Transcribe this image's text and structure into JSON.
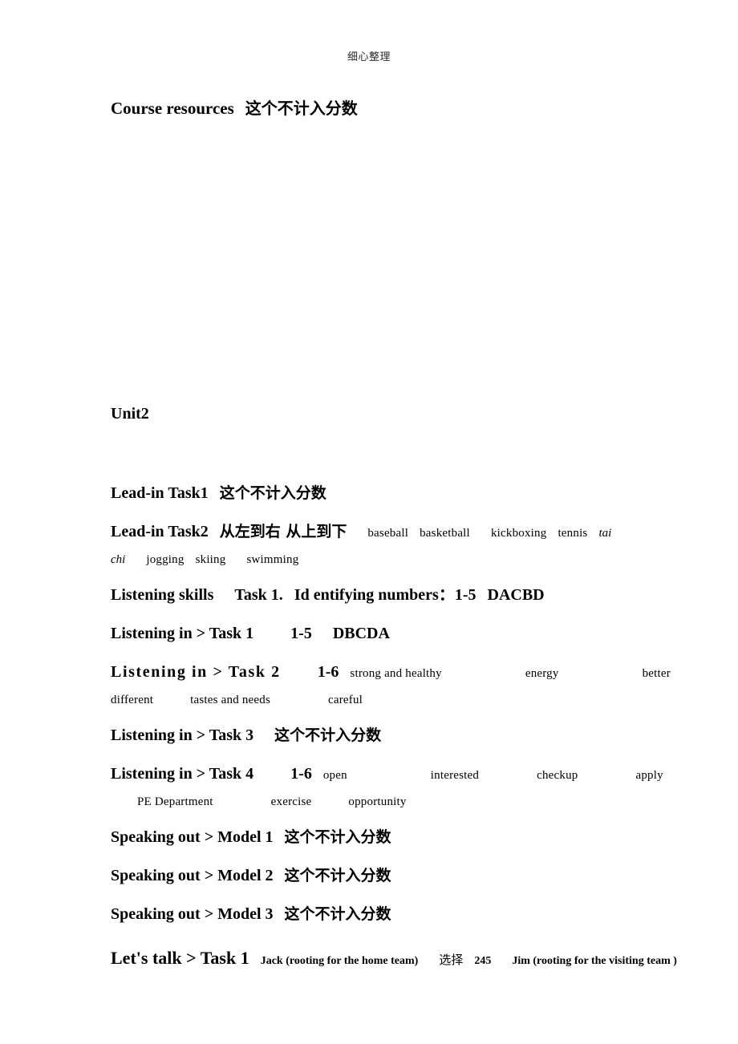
{
  "header": {
    "running_head": "细心整理"
  },
  "title_block": {
    "en": "Course resources",
    "zh": "这个不计入分数"
  },
  "unit": {
    "label": "Unit2"
  },
  "sections": {
    "lead_in_1": {
      "label": "Lead-in Task1",
      "zh": "这个不计入分数"
    },
    "lead_in_2": {
      "label": "Lead-in Task2",
      "zh_order": "从左到右 从上到下",
      "answers_line1": [
        "baseball",
        "basketball",
        "kickboxing",
        "tennis"
      ],
      "answer_italic_1": "tai",
      "answer_italic_2": "chi",
      "answers_line2": [
        "jogging",
        "skiing",
        "swimming"
      ]
    },
    "listening_skills": {
      "label": "Listening skills",
      "task": "Task 1.",
      "topic": "Id entifying numbers：",
      "range": "1-5",
      "answers": "DACBD"
    },
    "listening_in_1": {
      "label": "Listening in > Task 1",
      "range": "1-5",
      "answers": "DBCDA"
    },
    "listening_in_2": {
      "label": "Listening in > Task 2",
      "range": "1-6",
      "answers_line1": [
        "strong and healthy",
        "energy",
        "better"
      ],
      "answers_line2": [
        "different",
        "tastes and needs",
        "careful"
      ]
    },
    "listening_in_3": {
      "label": "Listening in > Task 3",
      "zh": "这个不计入分数"
    },
    "listening_in_4": {
      "label": "Listening in > Task 4",
      "range": "1-6",
      "answers_line1": [
        "open",
        "interested",
        "checkup",
        "apply"
      ],
      "answers_line2": [
        "PE Department",
        "exercise",
        "opportunity"
      ]
    },
    "speaking_out_1": {
      "label": "Speaking out > Model 1",
      "zh": "这个不计入分数"
    },
    "speaking_out_2": {
      "label": "Speaking out > Model 2",
      "zh": "这个不计入分数"
    },
    "speaking_out_3": {
      "label": "Speaking out > Model 3",
      "zh": "这个不计入分数"
    },
    "lets_talk_1": {
      "label": "Let's talk > Task 1",
      "answer_1": "Jack (rooting for the home team)",
      "zh_choose": "选择",
      "choice_numbers": "245",
      "answer_2": "Jim (rooting for the visiting team )"
    }
  }
}
